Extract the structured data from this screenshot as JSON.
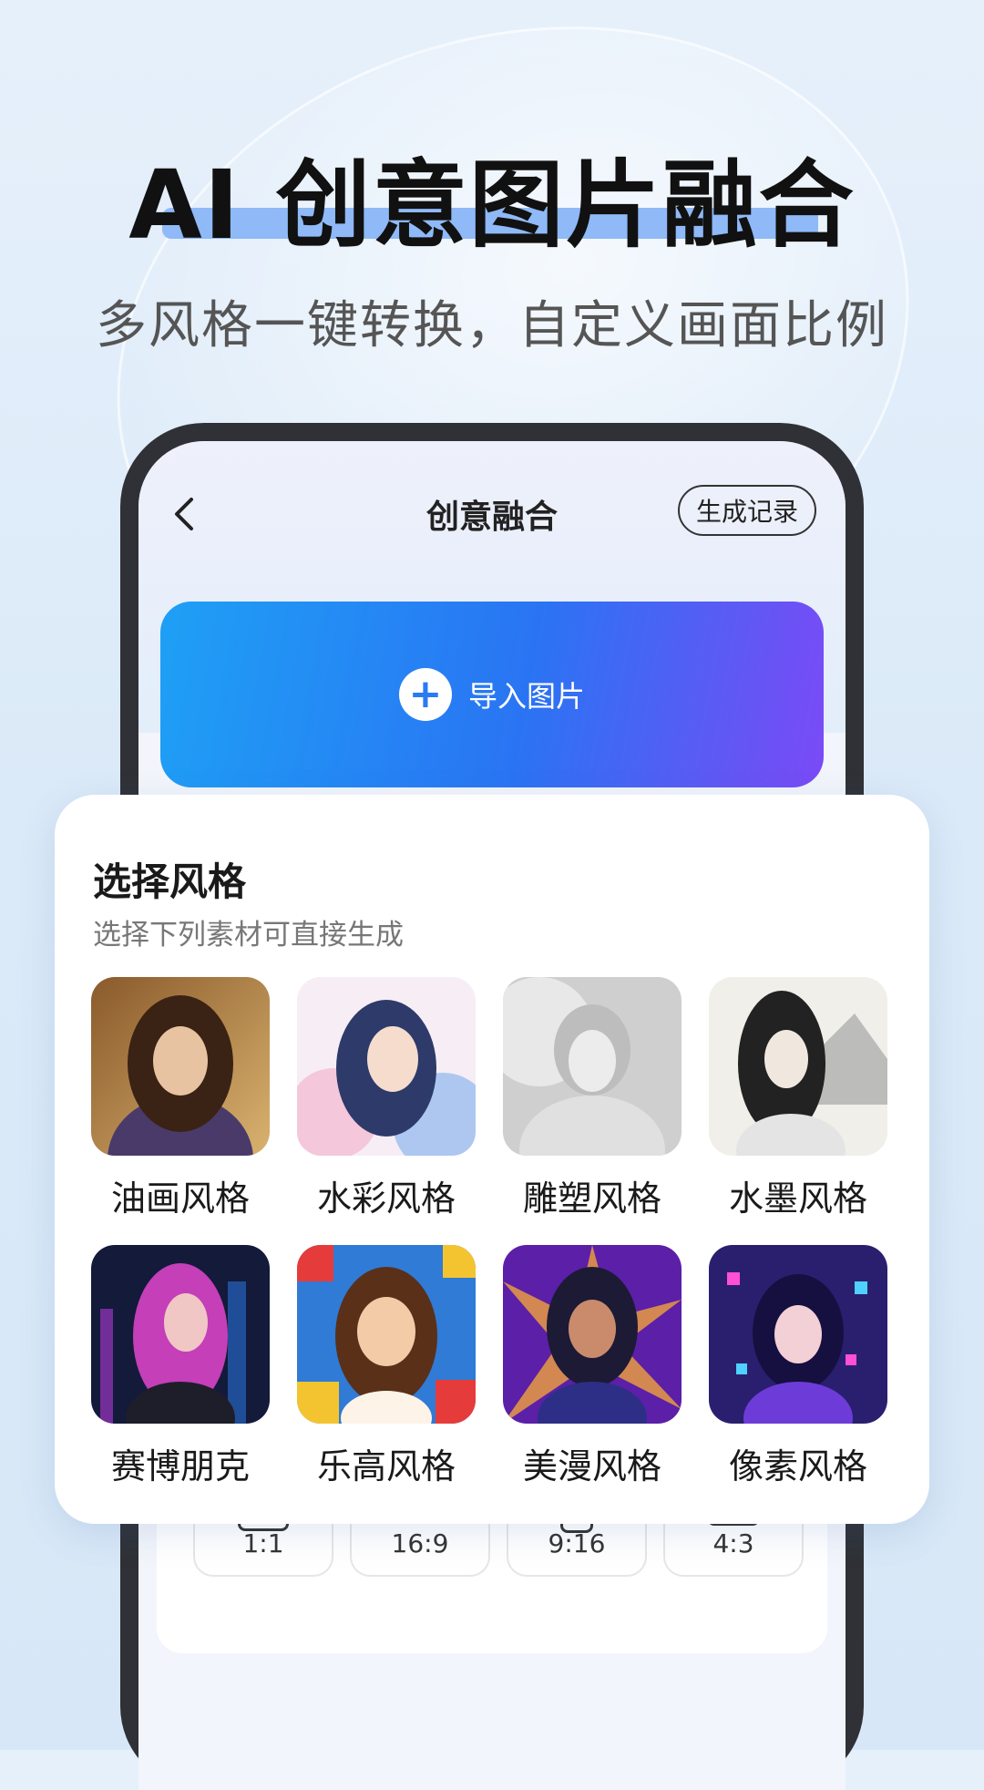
{
  "headline": "AI 创意图片融合",
  "subline": "多风格一键转换，自定义画面比例",
  "app": {
    "title": "创意融合",
    "history_button": "生成记录",
    "import_label": "导入图片"
  },
  "style_picker": {
    "title": "选择风格",
    "subtitle": "选择下列素材可直接生成",
    "styles": [
      {
        "label": "油画风格",
        "icon": "oil-painting-portrait"
      },
      {
        "label": "水彩风格",
        "icon": "watercolor-portrait"
      },
      {
        "label": "雕塑风格",
        "icon": "sculpture-portrait"
      },
      {
        "label": "水墨风格",
        "icon": "ink-wash-portrait"
      },
      {
        "label": "赛博朋克",
        "icon": "cyberpunk-portrait"
      },
      {
        "label": "乐高风格",
        "icon": "lego-portrait"
      },
      {
        "label": "美漫风格",
        "icon": "american-comic-portrait"
      },
      {
        "label": "像素风格",
        "icon": "pixel-portrait"
      }
    ]
  },
  "ratios": [
    {
      "label": "1:1"
    },
    {
      "label": "16:9"
    },
    {
      "label": "9:16"
    },
    {
      "label": "4:3"
    }
  ],
  "colors": {
    "accent_blue": "#2a74f3",
    "accent_purple": "#7b4af6",
    "highlight_bar": "#8fb9f7"
  }
}
